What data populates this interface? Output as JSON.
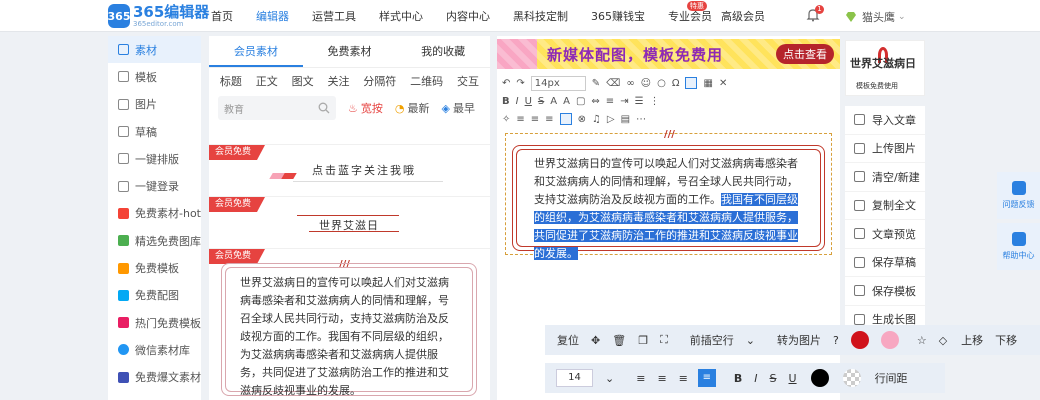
{
  "logo": {
    "mark": "365",
    "name": "365编辑器",
    "domain": "365editor.com"
  },
  "nav": [
    "首页",
    "编辑器",
    "运营工具",
    "样式中心",
    "内容中心",
    "黑科技定制",
    "365赚钱宝",
    "专业会员",
    "高级会员"
  ],
  "nav_badge": "特惠",
  "notifications": {
    "count": "1"
  },
  "user": {
    "name": "猫头鹰"
  },
  "leftnav": [
    {
      "label": "素材",
      "icon": "folder-icon"
    },
    {
      "label": "模板",
      "icon": "template-icon"
    },
    {
      "label": "图片",
      "icon": "image-icon"
    },
    {
      "label": "草稿",
      "icon": "draft-icon"
    },
    {
      "label": "一键排版",
      "icon": "layout-icon"
    },
    {
      "label": "一键登录",
      "icon": "login-icon"
    },
    {
      "label": "免费素材-hot",
      "icon": "free-material-icon"
    },
    {
      "label": "精选免费图库",
      "icon": "gallery-icon"
    },
    {
      "label": "免费模板",
      "icon": "free-template-icon"
    },
    {
      "label": "免费配图",
      "icon": "free-image-icon"
    },
    {
      "label": "热门免费模板",
      "icon": "hot-template-icon"
    },
    {
      "label": "微信素材库",
      "icon": "wechat-icon"
    },
    {
      "label": "免费爆文素材",
      "icon": "article-icon"
    }
  ],
  "material_tabs": [
    "会员素材",
    "免费素材",
    "我的收藏"
  ],
  "categories": [
    "标题",
    "正文",
    "图文",
    "关注",
    "分隔符",
    "二维码",
    "交互"
  ],
  "search": {
    "placeholder": "教育"
  },
  "sort": {
    "hot": "宽按",
    "new": "最新",
    "old": "最早"
  },
  "vip_label": "会员免费",
  "cards": {
    "follow_title": "点击蓝字关注我哦",
    "aids_title": "世界艾滋日",
    "body_text": "世界艾滋病日的宣传可以唤起人们对艾滋病病毒感染者和艾滋病病人的同情和理解，号召全球人民共同行动，支持艾滋病防治及反歧视方面的工作。我国有不同层级的组织，为艾滋病病毒感染者和艾滋病病人提供服务，共同促进了艾滋病防治工作的推进和艾滋病反歧视事业的发展。"
  },
  "banner": {
    "text": "新媒体配图，模板免费用",
    "button": "点击查看"
  },
  "editor": {
    "font_size": "14px",
    "text_normal": "世界艾滋病日的宣传可以唤起人们对艾滋病病毒感染者和艾滋病病人的同情和理解，号召全球人民共同行动，支持艾滋病防治及反歧视方面的工作。",
    "text_selected": "我国有不同层级的组织，为艾滋病病毒感染者和艾滋病病人提供服务，共同促进了艾滋病防治工作的推进和艾滋病反歧视事业的发展。"
  },
  "thumb": {
    "title": "世界艾滋病日",
    "subtitle": "模板免费使用"
  },
  "actions": [
    "导入文章",
    "上传图片",
    "清空/新建",
    "复制全文",
    "文章预览",
    "保存草稿",
    "保存模板",
    "生成长图"
  ],
  "side_buttons": [
    "问题反馈",
    "帮助中心"
  ],
  "ctx1": {
    "reset": "复位",
    "insert_before": "前插空行",
    "to_image": "转为图片",
    "move_up": "上移",
    "move_down": "下移"
  },
  "ctx2": {
    "font_size": "14",
    "line_spacing": "行间距",
    "bold": "B",
    "italic": "I",
    "strike": "S",
    "underline": "U"
  },
  "colors": {
    "accent": "#2a80e0",
    "red": "#e64340",
    "swatch_red": "#d0121b",
    "swatch_pink": "#f7a7c1",
    "swatch_black": "#000000"
  }
}
